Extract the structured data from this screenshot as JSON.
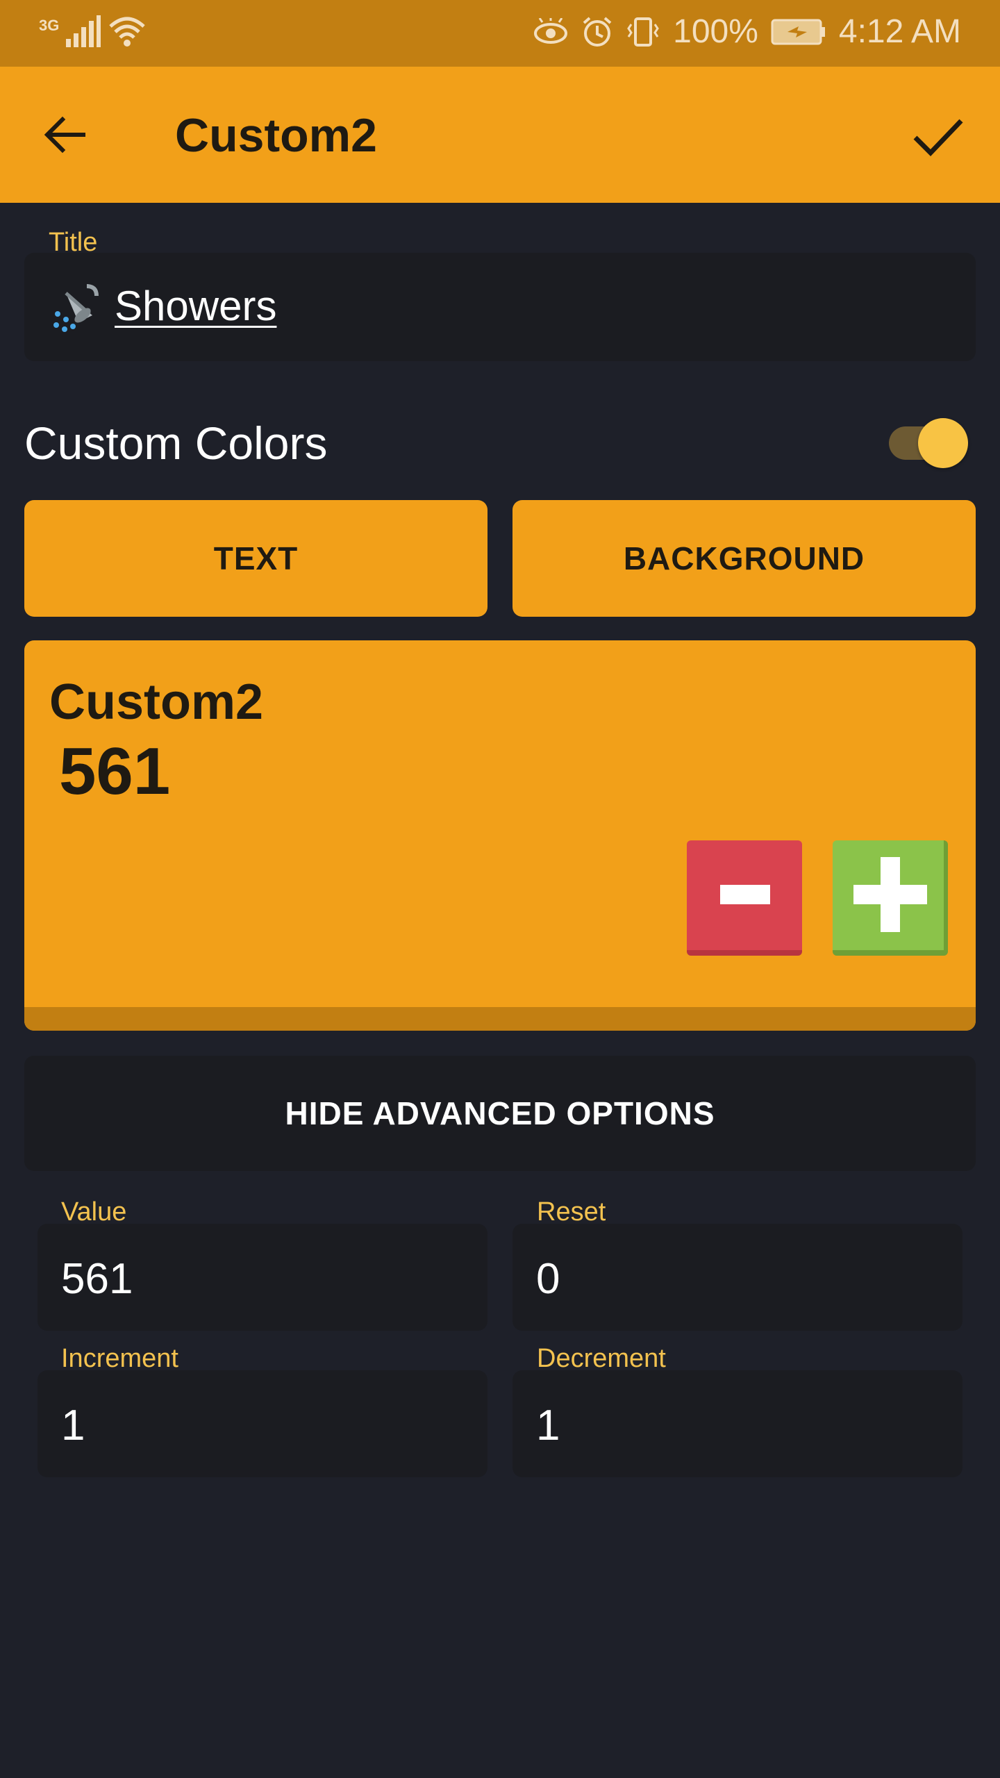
{
  "status_bar": {
    "network": "3G",
    "battery": "100%",
    "time": "4:12 AM"
  },
  "app_bar": {
    "title": "Custom2"
  },
  "title_field": {
    "label": "Title",
    "value": "Showers",
    "emoji_icon": "shower-icon"
  },
  "custom_colors": {
    "label": "Custom Colors",
    "enabled": true
  },
  "color_buttons": {
    "text": "TEXT",
    "background": "BACKGROUND"
  },
  "preview": {
    "title": "Custom2",
    "value": "561"
  },
  "advanced_toggle": "HIDE ADVANCED OPTIONS",
  "advanced": {
    "value": {
      "label": "Value",
      "value": "561"
    },
    "reset": {
      "label": "Reset",
      "value": "0"
    },
    "increment": {
      "label": "Increment",
      "value": "1"
    },
    "decrement": {
      "label": "Decrement",
      "value": "1"
    }
  },
  "colors": {
    "accent": "#f2a019",
    "accent_dark": "#c27f12",
    "background": "#1e2029",
    "field": "#1b1c21",
    "label": "#f3c24f",
    "minus": "#d9434f",
    "plus": "#8bc34a"
  }
}
